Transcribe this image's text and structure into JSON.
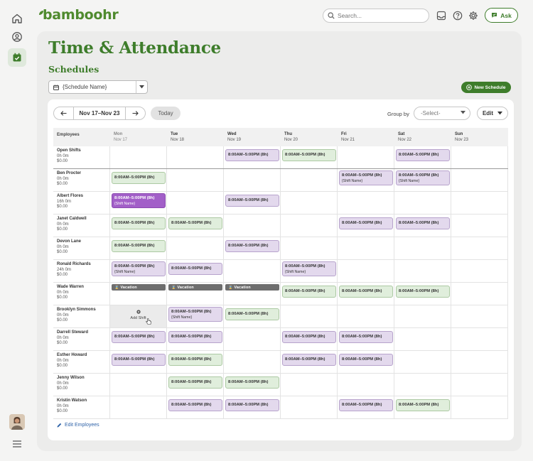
{
  "app": {
    "logo": "bamboohr"
  },
  "search": {
    "placeholder": "Search..."
  },
  "topbar": {
    "ask_label": "Ask"
  },
  "page": {
    "title": "Time & Attendance",
    "section": "Schedules"
  },
  "schedule_select": {
    "value": "{Schedule Name}"
  },
  "new_schedule_label": "New Schedule",
  "toolbar": {
    "range": "Nov 17–Nov 23",
    "today": "Today",
    "group_by_label": "Group by",
    "group_by_value": "-Select-",
    "edit": "Edit"
  },
  "grid": {
    "employees_header": "Employees",
    "days": [
      {
        "dow": "Mon",
        "date": "Nov 17"
      },
      {
        "dow": "Tue",
        "date": "Nov 18"
      },
      {
        "dow": "Wed",
        "date": "Nov 19"
      },
      {
        "dow": "Thu",
        "date": "Nov 20"
      },
      {
        "dow": "Fri",
        "date": "Nov 21"
      },
      {
        "dow": "Sat",
        "date": "Nov 22"
      },
      {
        "dow": "Sun",
        "date": "Nov 23"
      }
    ],
    "shift_time": "8:00AM–5:00PM (8h)",
    "shift_name": "{Shift Name}",
    "vacation_label": "Vacation",
    "add_shift_label": "Add Shift",
    "rows": [
      {
        "name": "Open Shifts",
        "hours": "0h 0m",
        "cost": "$0.00",
        "cells": [
          null,
          null,
          {
            "c": "purple"
          },
          {
            "c": "green"
          },
          null,
          {
            "c": "purple"
          },
          null
        ]
      },
      {
        "name": "Ben Procter",
        "hours": "0h 0m",
        "cost": "$0.00",
        "cells": [
          {
            "c": "green"
          },
          null,
          null,
          null,
          {
            "c": "purple",
            "sub": true
          },
          {
            "c": "purple",
            "sub": true
          },
          null
        ]
      },
      {
        "name": "Albert Flores",
        "hours": "16h 0m",
        "cost": "$0.00",
        "cells": [
          {
            "c": "dpurple",
            "sub": true
          },
          null,
          {
            "c": "purple"
          },
          null,
          null,
          null,
          null
        ]
      },
      {
        "name": "Janet Caldwell",
        "hours": "0h 0m",
        "cost": "$0.00",
        "cells": [
          {
            "c": "green"
          },
          {
            "c": "green"
          },
          null,
          null,
          {
            "c": "purple"
          },
          {
            "c": "purple"
          },
          null
        ]
      },
      {
        "name": "Devon Lane",
        "hours": "0h 0m",
        "cost": "$0.00",
        "cells": [
          {
            "c": "green"
          },
          null,
          {
            "c": "purple"
          },
          null,
          null,
          null,
          null
        ]
      },
      {
        "name": "Ronald Richards",
        "hours": "24h 0m",
        "cost": "$0.00",
        "cells": [
          {
            "c": "purple",
            "sub": true
          },
          {
            "c": "purple"
          },
          null,
          {
            "c": "purple",
            "sub": true
          },
          null,
          null,
          null
        ]
      },
      {
        "name": "Wade Warren",
        "hours": "0h 0m",
        "cost": "$0.00",
        "cells": [
          {
            "c": "vac"
          },
          {
            "c": "vac"
          },
          {
            "c": "vac"
          },
          {
            "c": "green"
          },
          {
            "c": "green"
          },
          {
            "c": "green"
          },
          null
        ]
      },
      {
        "name": "Brooklyn Simmons",
        "hours": "0h 0m",
        "cost": "$0.00",
        "cells": [
          {
            "c": "add"
          },
          {
            "c": "purple",
            "sub": true
          },
          {
            "c": "green"
          },
          null,
          null,
          null,
          null
        ]
      },
      {
        "name": "Darrell Steward",
        "hours": "0h 0m",
        "cost": "$0.00",
        "cells": [
          {
            "c": "purple"
          },
          {
            "c": "purple"
          },
          null,
          {
            "c": "purple"
          },
          {
            "c": "purple"
          },
          null,
          null
        ]
      },
      {
        "name": "Esther Howard",
        "hours": "0h 0m",
        "cost": "$0.00",
        "cells": [
          {
            "c": "purple"
          },
          {
            "c": "green"
          },
          null,
          {
            "c": "purple"
          },
          {
            "c": "purple"
          },
          null,
          null
        ]
      },
      {
        "name": "Jenny Wilson",
        "hours": "0h 0m",
        "cost": "$0.00",
        "cells": [
          null,
          {
            "c": "green"
          },
          {
            "c": "green"
          },
          null,
          null,
          null,
          null
        ]
      },
      {
        "name": "Kristin Watson",
        "hours": "0h 0m",
        "cost": "$0.00",
        "cells": [
          null,
          {
            "c": "purple"
          },
          {
            "c": "purple"
          },
          null,
          {
            "c": "purple"
          },
          {
            "c": "green"
          },
          null
        ]
      }
    ]
  },
  "edit_employees_label": "Edit Employees",
  "colors": {
    "brand": "#3e7d2b",
    "shift_purple": "#e3d9ed",
    "shift_green": "#e0eedc",
    "selected_purple": "#a25fc8",
    "vacation": "#6e6e6e"
  }
}
